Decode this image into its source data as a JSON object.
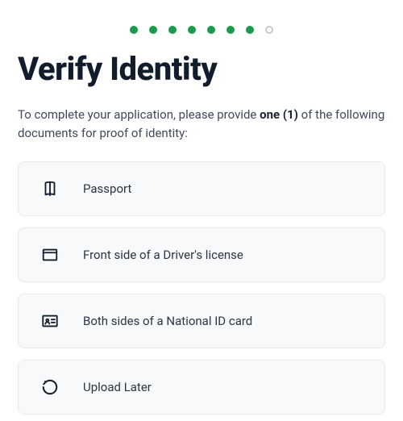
{
  "stepper": {
    "total": 8,
    "completed": 7
  },
  "title": "Verify Identity",
  "instruction": {
    "prefix": "To complete your application, please provide ",
    "bold": "one (1)",
    "suffix": " of the following documents for proof of identity:"
  },
  "options": [
    {
      "icon": "passport-icon",
      "label": "Passport"
    },
    {
      "icon": "card-front-icon",
      "label": "Front side of a Driver's license"
    },
    {
      "icon": "id-card-icon",
      "label": "Both sides of a National ID card"
    },
    {
      "icon": "upload-later-icon",
      "label": "Upload Later"
    }
  ]
}
